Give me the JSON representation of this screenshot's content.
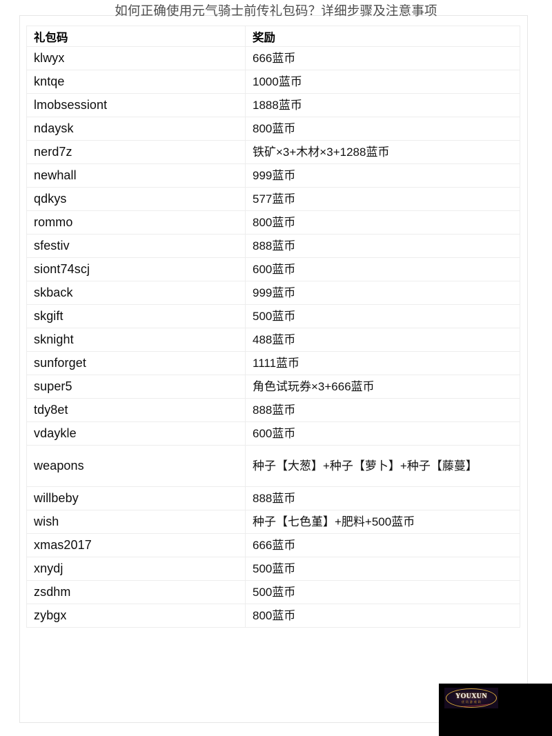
{
  "page": {
    "title": "如何正确使用元气骑士前传礼包码？详细步骤及注意事项",
    "background_color": "#ffffff",
    "card_border_color": "#e6e6e6"
  },
  "table": {
    "headers": {
      "code": "礼包码",
      "reward": "奖励"
    },
    "rows": [
      {
        "code": "klwyx",
        "reward": "666蓝币"
      },
      {
        "code": "kntqe",
        "reward": "1000蓝币"
      },
      {
        "code": "lmobsessiont",
        "reward": "1888蓝币"
      },
      {
        "code": "ndaysk",
        "reward": "800蓝币"
      },
      {
        "code": "nerd7z",
        "reward": "铁矿×3+木材×3+1288蓝币"
      },
      {
        "code": "newhall",
        "reward": "999蓝币"
      },
      {
        "code": "qdkys",
        "reward": "577蓝币"
      },
      {
        "code": "rommo",
        "reward": "800蓝币"
      },
      {
        "code": "sfestiv",
        "reward": "888蓝币"
      },
      {
        "code": "siont74scj",
        "reward": "600蓝币"
      },
      {
        "code": "skback",
        "reward": "999蓝币"
      },
      {
        "code": "skgift",
        "reward": "500蓝币"
      },
      {
        "code": "sknight",
        "reward": "488蓝币"
      },
      {
        "code": "sunforget",
        "reward": "1111蓝币"
      },
      {
        "code": "super5",
        "reward": "角色试玩券×3+666蓝币"
      },
      {
        "code": "tdy8et",
        "reward": "888蓝币"
      },
      {
        "code": "vdaykle",
        "reward": "600蓝币"
      },
      {
        "code": "weapons",
        "reward": "种子【大葱】+种子【萝卜】+种子【藤蔓】",
        "tall": true
      },
      {
        "code": "willbeby",
        "reward": "888蓝币"
      },
      {
        "code": "wish",
        "reward": "种子【七色堇】+肥料+500蓝币"
      },
      {
        "code": "xmas2017",
        "reward": "666蓝币"
      },
      {
        "code": "xnydj",
        "reward": "500蓝币"
      },
      {
        "code": "zsdhm",
        "reward": "500蓝币"
      },
      {
        "code": "zybgx",
        "reward": "800蓝币"
      }
    ]
  },
  "watermark": {
    "logo_main": "YOUXUN",
    "logo_sub": "优 讯 游 戏 网",
    "background_color": "#000000",
    "accent_color": "#d8a93a"
  }
}
